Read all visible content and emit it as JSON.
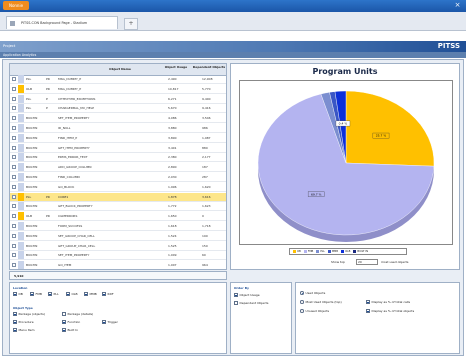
{
  "window": {
    "menu_label": "Nonnie",
    "close_glyph": "×"
  },
  "tab": {
    "label": "PITSS.CON Background Page - Stadium",
    "new_glyph": "+"
  },
  "header": {
    "left_label": "Project",
    "brand": "PITSS",
    "breadcrumb": "Application Analytics"
  },
  "table": {
    "columns": [
      "Object Name",
      "Object Usage",
      "Dependent Objects"
    ],
    "rows": [
      {
        "type": "PLL",
        "kind": "PR",
        "name": "MSG_DUMMY_P",
        "usage": "2,490",
        "dep": "12,908",
        "color": "#c8d3ea",
        "hl": false
      },
      {
        "type": "OLB",
        "kind": "PR",
        "name": "MSG_DUMMY_P",
        "usage": "10,817",
        "dep": "5,770",
        "color": "#ffc000",
        "hl": false
      },
      {
        "type": "PLL",
        "kind": "P",
        "name": "CHTEXTIHR_EXCEPTIONS",
        "usage": "6,271",
        "dep": "9,400",
        "color": "#c8d3ea",
        "hl": false
      },
      {
        "type": "PLL",
        "kind": "P",
        "name": "CHARGEDBAL_MX_HELP",
        "usage": "5,670",
        "dep": "9,416",
        "color": "#c8d3ea",
        "hl": false
      },
      {
        "type": "BUILTIN",
        "kind": "",
        "name": "SET_ITEM_PROPERTY",
        "usage": "4,086",
        "dep": "3,546",
        "color": "#c8d3ea",
        "hl": false
      },
      {
        "type": "BUILTIN",
        "kind": "",
        "name": "ID_NULL",
        "usage": "3,880",
        "dep": "986",
        "color": "#c8d3ea",
        "hl": false
      },
      {
        "type": "BUILTIN",
        "kind": "",
        "name": "FIND_ITEM_P",
        "usage": "3,890",
        "dep": "1,987",
        "color": "#c8d3ea",
        "hl": false
      },
      {
        "type": "BUILTIN",
        "kind": "",
        "name": "GET_ITEM_PROPERTY",
        "usage": "3,401",
        "dep": "880",
        "color": "#c8d3ea",
        "hl": false
      },
      {
        "type": "BUILTIN",
        "kind": "",
        "name": "ERMS_ERROR_TEXT",
        "usage": "2,380",
        "dep": "2,177",
        "color": "#c8d3ea",
        "hl": false
      },
      {
        "type": "BUILTIN",
        "kind": "",
        "name": "ADD_GROUP_COLUMN",
        "usage": "2,890",
        "dep": "187",
        "color": "#c8d3ea",
        "hl": false
      },
      {
        "type": "BUILTIN",
        "kind": "",
        "name": "FIND_COLUMN",
        "usage": "2,030",
        "dep": "287",
        "color": "#c8d3ea",
        "hl": false
      },
      {
        "type": "BUILTIN",
        "kind": "",
        "name": "GO_BLOCK",
        "usage": "1,996",
        "dep": "1,620",
        "color": "#c8d3ea",
        "hl": false
      },
      {
        "type": "PLL",
        "kind": "PR",
        "name": "CORE1",
        "usage": "1,878",
        "dep": "3,616",
        "color": "#ffc000",
        "hl": true
      },
      {
        "type": "BUILTIN",
        "kind": "",
        "name": "GET_BLOCK_PROPERTY",
        "usage": "1,772",
        "dep": "1,623",
        "color": "#c8d3ea",
        "hl": false
      },
      {
        "type": "OLB",
        "kind": "PR",
        "name": "CGMERRORS",
        "usage": "1,650",
        "dep": "0",
        "color": "#ffc000",
        "hl": false
      },
      {
        "type": "BUILTIN",
        "kind": "",
        "name": "FORM_SUCCESS",
        "usage": "1,618",
        "dep": "1,718",
        "color": "#c8d3ea",
        "hl": false
      },
      {
        "type": "BUILTIN",
        "kind": "",
        "name": "SET_GROUP_CHAR_CELL",
        "usage": "1,524",
        "dep": "190",
        "color": "#c8d3ea",
        "hl": false
      },
      {
        "type": "BUILTIN",
        "kind": "",
        "name": "GET_GROUP_CHAR_CELL",
        "usage": "1,525",
        "dep": "150",
        "color": "#c8d3ea",
        "hl": false
      },
      {
        "type": "BUILTIN",
        "kind": "",
        "name": "SET_ITEM_PROPERTY",
        "usage": "1,009",
        "dep": "60",
        "color": "#c8d3ea",
        "hl": false
      },
      {
        "type": "BUILTIN",
        "kind": "",
        "name": "GO_ITEM",
        "usage": "1,007",
        "dep": "964",
        "color": "#c8d3ea",
        "hl": false
      }
    ],
    "summary": "5,910"
  },
  "chart_data": {
    "type": "pie",
    "title": "Program Units",
    "slices": [
      {
        "label": "25.7 %",
        "value": 25.7,
        "color": "#ffc000"
      },
      {
        "label": "69.7 %",
        "value": 69.7,
        "color": "#b4b4f0"
      },
      {
        "label": "",
        "value": 1.6,
        "color": "#7b8ed0"
      },
      {
        "label": "",
        "value": 1.0,
        "color": "#3a56c5"
      },
      {
        "label": "0.4 %",
        "value": 2.0,
        "color": "#0d2fd8"
      }
    ],
    "legend": [
      "OB",
      "FMB",
      "PLL",
      "MMB",
      "OLB",
      "BUILT IN"
    ],
    "legend_colors": [
      "#ffc000",
      "#b4b4f0",
      "#7b8ed0",
      "#3a56c5",
      "#0d2fd8",
      "#1c2a80"
    ]
  },
  "show_top": {
    "label": "Show top",
    "value": "20",
    "suffix": "most used objects"
  },
  "location": {
    "title": "Location",
    "options": [
      {
        "label": "DB",
        "checked": true
      },
      {
        "label": "FMB",
        "checked": true
      },
      {
        "label": "PLL",
        "checked": true
      },
      {
        "label": "OLB",
        "checked": true
      },
      {
        "label": "MMB",
        "checked": true
      },
      {
        "label": "RDF",
        "checked": true
      }
    ]
  },
  "object_type": {
    "title": "Object Type",
    "options": [
      {
        "label": "Package (objects)",
        "checked": true
      },
      {
        "label": "Package (details)",
        "checked": false
      },
      {
        "label": "Procedure",
        "checked": true
      },
      {
        "label": "Function",
        "checked": true
      },
      {
        "label": "Trigger",
        "checked": true
      },
      {
        "label": "Menu Item",
        "checked": true
      },
      {
        "label": "Built In",
        "checked": true
      }
    ]
  },
  "order_by": {
    "title": "Order By",
    "options": [
      {
        "label": "Object Usage",
        "checked": true
      },
      {
        "label": "Dependent Objects",
        "checked": false
      }
    ]
  },
  "display": {
    "options": [
      {
        "label": "Used Objects",
        "checked": true,
        "kind": "radio"
      },
      {
        "label": "Most Used Objects (top)",
        "checked": false,
        "kind": "radio"
      },
      {
        "label": "Display as % of total calls",
        "checked": true,
        "kind": "check"
      },
      {
        "label": "Unused Objects",
        "checked": false,
        "kind": "radio"
      },
      {
        "label": "Display as % of total objects",
        "checked": true,
        "kind": "check"
      }
    ]
  }
}
